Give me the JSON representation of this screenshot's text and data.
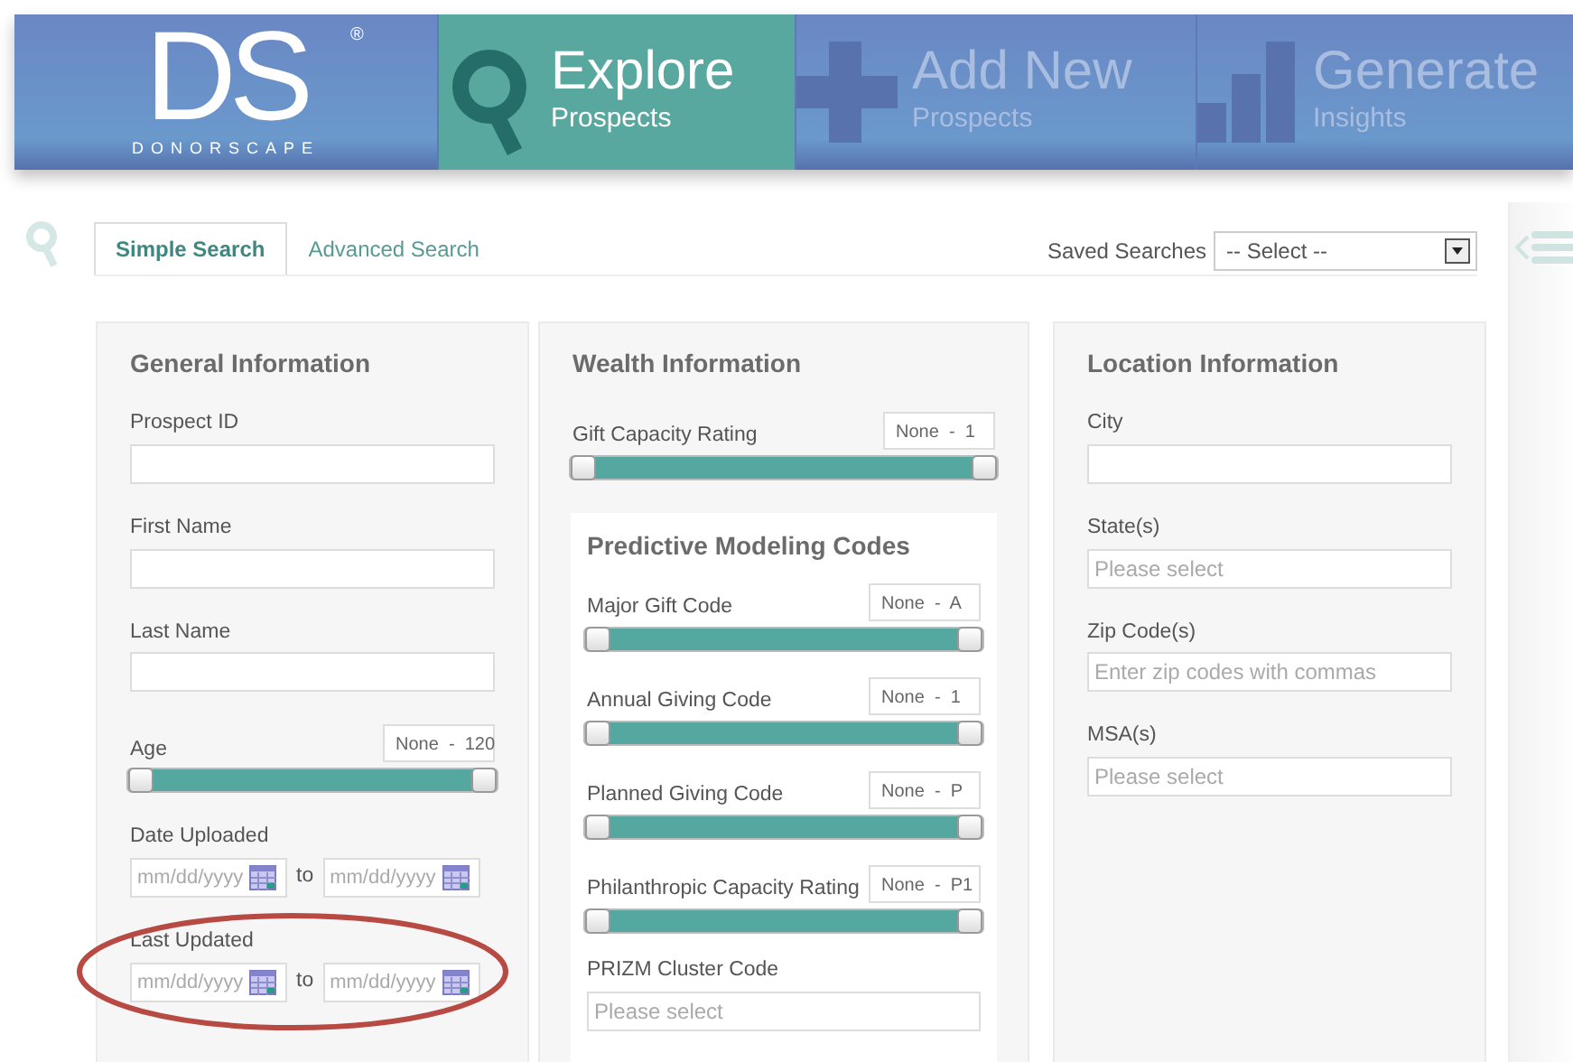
{
  "header": {
    "logo": {
      "mark": "DS",
      "registered": "®",
      "name": "DONORSCAPE"
    },
    "items": [
      {
        "kind": "search",
        "title": "Explore",
        "subtitle": "Prospects",
        "selected": true
      },
      {
        "kind": "plus",
        "title": "Add New",
        "subtitle": "Prospects",
        "selected": false
      },
      {
        "kind": "chart",
        "title": "Generate",
        "subtitle": "Insights",
        "selected": false
      }
    ]
  },
  "search_tabs": [
    {
      "label": "Simple Search",
      "selected": true
    },
    {
      "label": "Advanced Search",
      "selected": false
    }
  ],
  "saved_searches": {
    "label": "Saved Searches",
    "value": "-- Select --"
  },
  "panels": [
    {
      "title": "General Information",
      "fields": [
        {
          "kind": "text",
          "label": "Prospect ID"
        },
        {
          "kind": "text",
          "label": "First Name"
        },
        {
          "kind": "text",
          "label": "Last Name"
        },
        {
          "kind": "slider",
          "label": "Age",
          "range": "None  -  120",
          "level": 1
        },
        {
          "kind": "date_range",
          "label": "Date Uploaded",
          "from_placeholder": "mm/dd/yyyy",
          "separator": "to",
          "to_placeholder": "mm/dd/yyyy",
          "highlighted": false
        },
        {
          "kind": "date_range",
          "label": "Last Updated",
          "from_placeholder": "mm/dd/yyyy",
          "separator": "to",
          "to_placeholder": "mm/dd/yyyy",
          "highlighted": true
        }
      ]
    },
    {
      "title": "Wealth Information",
      "fields": [
        {
          "kind": "slider",
          "label": "Gift Capacity Rating",
          "range": "None  -  1",
          "level": 1
        },
        {
          "kind": "group",
          "title": "Predictive Modeling Codes",
          "fields": [
            {
              "kind": "slider",
              "label": "Major Gift Code",
              "range": "None  -  A",
              "level": 1
            },
            {
              "kind": "slider",
              "label": "Annual Giving Code",
              "range": "None  -  1",
              "level": 1
            },
            {
              "kind": "slider",
              "label": "Planned Giving Code",
              "range": "None  -  P",
              "level": 1
            },
            {
              "kind": "slider",
              "label": "Philanthropic Capacity Rating",
              "range": "None  -  P1",
              "level": 1
            },
            {
              "kind": "select",
              "label": "PRIZM Cluster Code",
              "placeholder": "Please select"
            }
          ]
        }
      ]
    },
    {
      "title": "Location Information",
      "fields": [
        {
          "kind": "text",
          "label": "City"
        },
        {
          "kind": "select",
          "label": "State(s)",
          "placeholder": "Please select"
        },
        {
          "kind": "select",
          "label": "Zip Code(s)",
          "placeholder": "Enter zip codes with commas"
        },
        {
          "kind": "select",
          "label": "MSA(s)",
          "placeholder": "Please select"
        }
      ]
    }
  ]
}
